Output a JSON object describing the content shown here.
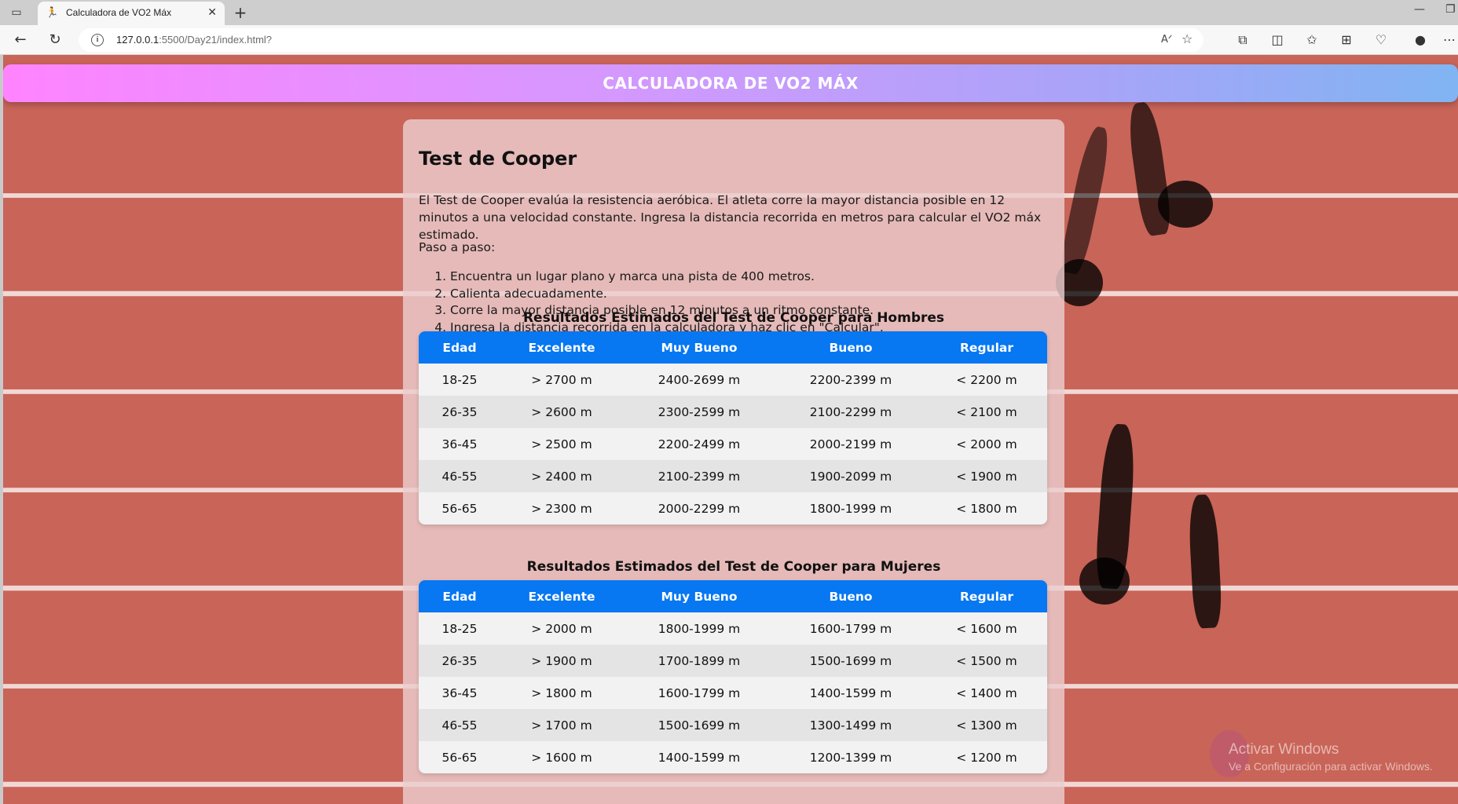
{
  "browser": {
    "tab_title": "Calculadora de VO2 Máx",
    "url_host": "127.0.0.1",
    "url_path": ":5500/Day21/index.html?"
  },
  "page": {
    "header_title": "CALCULADORA DE VO2 MÁX",
    "section_title": "Test de Cooper",
    "intro": "El Test de Cooper evalúa la resistencia aeróbica. El atleta corre la mayor distancia posible en 12 minutos a una velocidad constante. Ingresa la distancia recorrida en metros para calcular el VO2 máx estimado.",
    "steps_heading": "Paso a paso:",
    "steps": [
      "Encuentra un lugar plano y marca una pista de 400 metros.",
      "Calienta adecuadamente.",
      "Corre la mayor distancia posible en 12 minutos a un ritmo constante.",
      "Ingresa la distancia recorrida en la calculadora y haz clic en \"Calcular\"."
    ],
    "men_table": {
      "title": "Resultados Estimados del Test de Cooper para Hombres",
      "headers": [
        "Edad",
        "Excelente",
        "Muy Bueno",
        "Bueno",
        "Regular"
      ],
      "rows": [
        [
          "18-25",
          "> 2700 m",
          "2400-2699 m",
          "2200-2399 m",
          "< 2200 m"
        ],
        [
          "26-35",
          "> 2600 m",
          "2300-2599 m",
          "2100-2299 m",
          "< 2100 m"
        ],
        [
          "36-45",
          "> 2500 m",
          "2200-2499 m",
          "2000-2199 m",
          "< 2000 m"
        ],
        [
          "46-55",
          "> 2400 m",
          "2100-2399 m",
          "1900-2099 m",
          "< 1900 m"
        ],
        [
          "56-65",
          "> 2300 m",
          "2000-2299 m",
          "1800-1999 m",
          "< 1800 m"
        ]
      ]
    },
    "women_table": {
      "title": "Resultados Estimados del Test de Cooper para Mujeres",
      "headers": [
        "Edad",
        "Excelente",
        "Muy Bueno",
        "Bueno",
        "Regular"
      ],
      "rows": [
        [
          "18-25",
          "> 2000 m",
          "1800-1999 m",
          "1600-1799 m",
          "< 1600 m"
        ],
        [
          "26-35",
          "> 1900 m",
          "1700-1899 m",
          "1500-1699 m",
          "< 1500 m"
        ],
        [
          "36-45",
          "> 1800 m",
          "1600-1799 m",
          "1400-1599 m",
          "< 1400 m"
        ],
        [
          "46-55",
          "> 1700 m",
          "1500-1699 m",
          "1300-1499 m",
          "< 1300 m"
        ],
        [
          "56-65",
          "> 1600 m",
          "1400-1599 m",
          "1200-1399 m",
          "< 1200 m"
        ]
      ]
    }
  },
  "os": {
    "watermark_line1": "Activar Windows",
    "watermark_line2": "Ve a Configuración para activar Windows."
  }
}
